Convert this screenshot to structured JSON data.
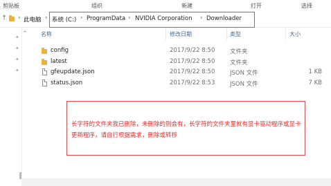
{
  "ribbon": {
    "groups": [
      "剪贴板",
      "组织",
      "新建",
      "打开",
      "选择"
    ]
  },
  "address": {
    "this_pc": "此电脑",
    "crumbs": [
      "系统 (C:)",
      "ProgramData",
      "NVIDIA Corporation",
      "Downloader"
    ]
  },
  "columns": {
    "name": "名称",
    "date": "修改日期",
    "type": "类型",
    "size": "大小"
  },
  "files": [
    {
      "name": "config",
      "date": "2017/9/22 8:50",
      "type": "文件夹",
      "size": "",
      "kind": "folder"
    },
    {
      "name": "latest",
      "date": "2017/9/22 8:50",
      "type": "文件夹",
      "size": "",
      "kind": "folder"
    },
    {
      "name": "gfeupdate.json",
      "date": "2017/9/22 8:50",
      "type": "JSON 文件",
      "size": "1 KB",
      "kind": "file"
    },
    {
      "name": "status.json",
      "date": "2017/9/22 8:53",
      "type": "JSON 文件",
      "size": "7 KB",
      "kind": "file"
    }
  ],
  "note": {
    "text": "长字符的文件夹我已删除，未删除的则会有，长字符的文件夹里就有显卡驱动程序或显卡更新程序，请自行根据需求，删除或转移"
  },
  "colors": {
    "annotation_red": "#e84848",
    "folder_yellow": "#e9b23a"
  }
}
